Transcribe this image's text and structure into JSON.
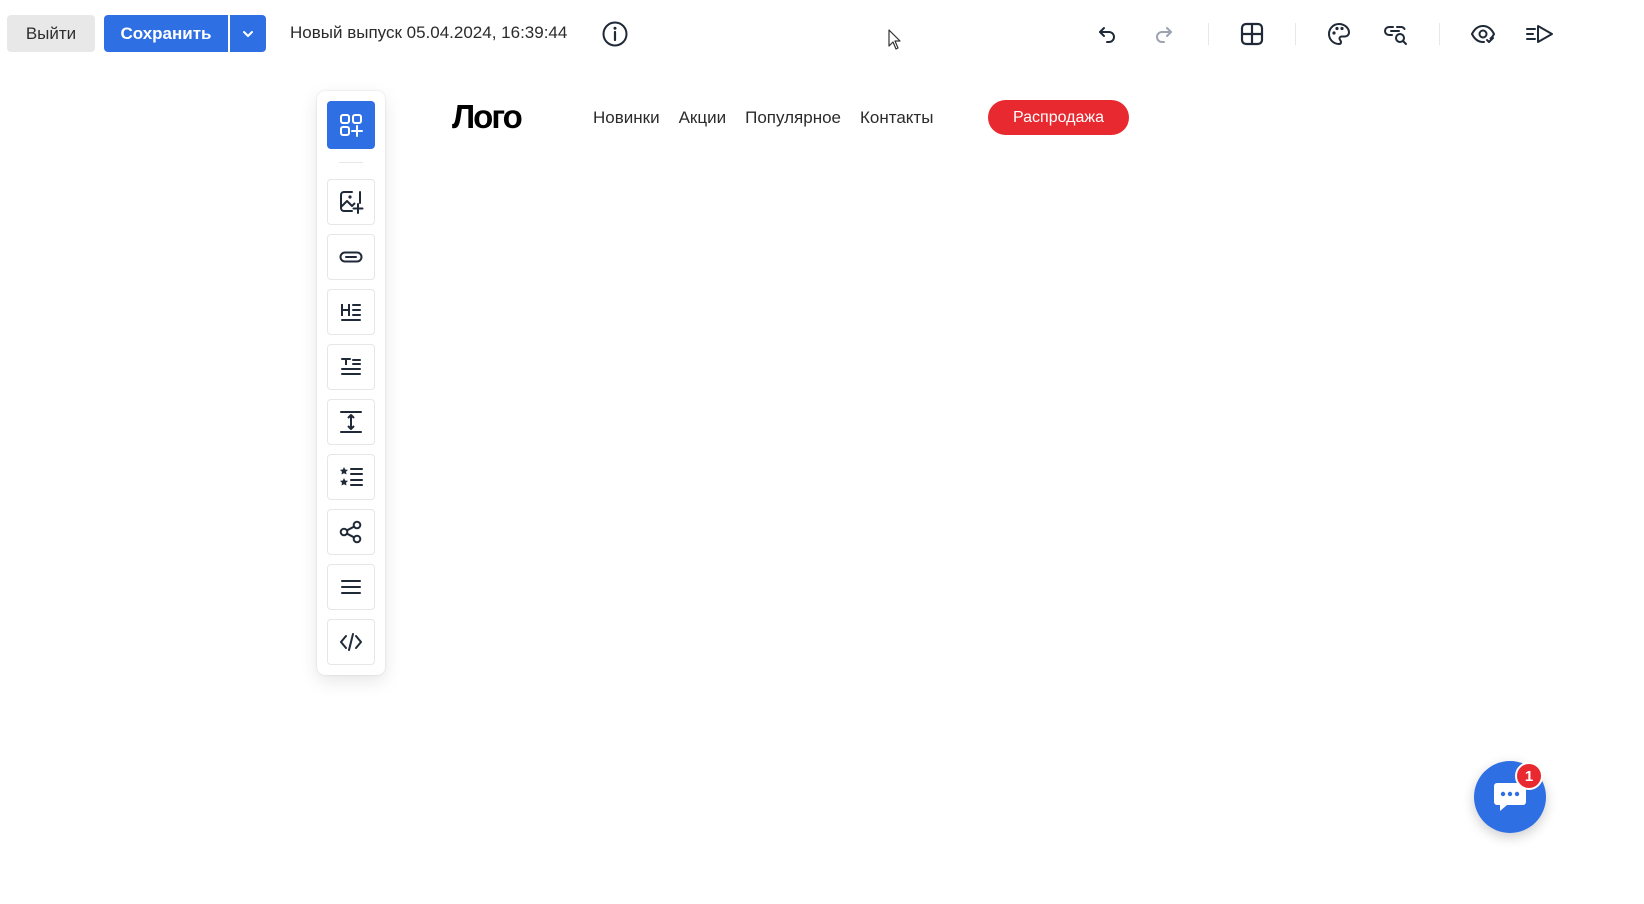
{
  "toolbar": {
    "exit_label": "Выйти",
    "save_label": "Сохранить",
    "release_title": "Новый выпуск 05.04.2024, 16:39:44",
    "icons": [
      "info-icon",
      "undo-icon",
      "redo-icon",
      "layout-grid-icon",
      "palette-icon",
      "link-search-icon",
      "preview-eye-icon",
      "send-icon"
    ]
  },
  "sidebar": {
    "main": "add-block-icon",
    "items": [
      {
        "icon": "image-add-icon",
        "title": "Изображение"
      },
      {
        "icon": "button-icon",
        "title": "Кнопка"
      },
      {
        "icon": "heading-icon",
        "title": "Заголовок"
      },
      {
        "icon": "text-icon",
        "title": "Текст"
      },
      {
        "icon": "spacer-icon",
        "title": "Отступ"
      },
      {
        "icon": "list-icon",
        "title": "Список"
      },
      {
        "icon": "share-icon",
        "title": "Соцсети"
      },
      {
        "icon": "menu-icon",
        "title": "Меню"
      },
      {
        "icon": "code-icon",
        "title": "HTML"
      }
    ]
  },
  "canvas": {
    "logo": "Лого",
    "nav": [
      "Новинки",
      "Акции",
      "Популярное",
      "Контакты"
    ],
    "sale_button": "Распродажа"
  },
  "chat": {
    "badge": "1"
  },
  "colors": {
    "primary": "#2f6fe4",
    "accent_red": "#e8292f",
    "text": "#2b2b2b"
  }
}
